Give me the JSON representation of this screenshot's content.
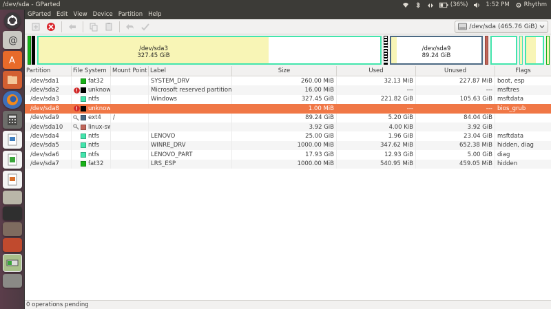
{
  "window": {
    "title": "/dev/sda - GParted"
  },
  "indicators": {
    "battery": "(36%)",
    "time": "1:52 PM",
    "user": "Rhythm"
  },
  "menu": [
    "GParted",
    "Edit",
    "View",
    "Device",
    "Partition",
    "Help"
  ],
  "device": {
    "label": "/dev/sda",
    "size": "(465.76 GiB)"
  },
  "diskmap": {
    "sda3": {
      "name": "/dev/sda3",
      "size": "327.45 GiB"
    },
    "sda9": {
      "name": "/dev/sda9",
      "size": "89.24 GiB"
    }
  },
  "columns": [
    "Partition",
    "File System",
    "Mount Point",
    "Label",
    "Size",
    "Used",
    "Unused",
    "Flags"
  ],
  "colors": {
    "fat32": "#18b218",
    "unknown": "#000000",
    "ntfs": "#42e5ac",
    "ext4": "#4b6983",
    "linux_swap": "#c1665a",
    "selection": "#f07746"
  },
  "partitions": [
    {
      "name": "/dev/sda1",
      "icon": "",
      "fs": "fat32",
      "color": "#18b218",
      "mount": "",
      "label": "SYSTEM_DRV",
      "size": "260.00 MiB",
      "used": "32.13 MiB",
      "unused": "227.87 MiB",
      "flags": "boot, esp"
    },
    {
      "name": "/dev/sda2",
      "icon": "warning-icon",
      "fs": "unknown",
      "color": "#000000",
      "mount": "",
      "label": "Microsoft reserved partition",
      "size": "16.00 MiB",
      "used": "---",
      "unused": "---",
      "flags": "msftres"
    },
    {
      "name": "/dev/sda3",
      "icon": "",
      "fs": "ntfs",
      "color": "#42e5ac",
      "mount": "",
      "label": "Windows",
      "size": "327.45 GiB",
      "used": "221.82 GiB",
      "unused": "105.63 GiB",
      "flags": "msftdata"
    },
    {
      "name": "/dev/sda8",
      "icon": "warning-icon",
      "fs": "unknown",
      "color": "#000000",
      "mount": "",
      "label": "",
      "size": "1.00 MiB",
      "used": "---",
      "unused": "---",
      "flags": "bios_grub",
      "selected": true
    },
    {
      "name": "/dev/sda9",
      "icon": "key-icon",
      "fs": "ext4",
      "color": "#4b6983",
      "mount": "/",
      "label": "",
      "size": "89.24 GiB",
      "used": "5.20 GiB",
      "unused": "84.04 GiB",
      "flags": ""
    },
    {
      "name": "/dev/sda10",
      "icon": "key-icon",
      "fs": "linux-swap",
      "color": "#c1665a",
      "mount": "",
      "label": "",
      "size": "3.92 GiB",
      "used": "4.00 KiB",
      "unused": "3.92 GiB",
      "flags": ""
    },
    {
      "name": "/dev/sda4",
      "icon": "",
      "fs": "ntfs",
      "color": "#42e5ac",
      "mount": "",
      "label": "LENOVO",
      "size": "25.00 GiB",
      "used": "1.96 GiB",
      "unused": "23.04 GiB",
      "flags": "msftdata"
    },
    {
      "name": "/dev/sda5",
      "icon": "",
      "fs": "ntfs",
      "color": "#42e5ac",
      "mount": "",
      "label": "WINRE_DRV",
      "size": "1000.00 MiB",
      "used": "347.62 MiB",
      "unused": "652.38 MiB",
      "flags": "hidden, diag"
    },
    {
      "name": "/dev/sda6",
      "icon": "",
      "fs": "ntfs",
      "color": "#42e5ac",
      "mount": "",
      "label": "LENOVO_PART",
      "size": "17.93 GiB",
      "used": "12.93 GiB",
      "unused": "5.00 GiB",
      "flags": "diag"
    },
    {
      "name": "/dev/sda7",
      "icon": "",
      "fs": "fat32",
      "color": "#18b218",
      "mount": "",
      "label": "LRS_ESP",
      "size": "1000.00 MiB",
      "used": "540.95 MiB",
      "unused": "459.05 MiB",
      "flags": "hidden"
    }
  ],
  "status": {
    "text": "0 operations pending"
  }
}
